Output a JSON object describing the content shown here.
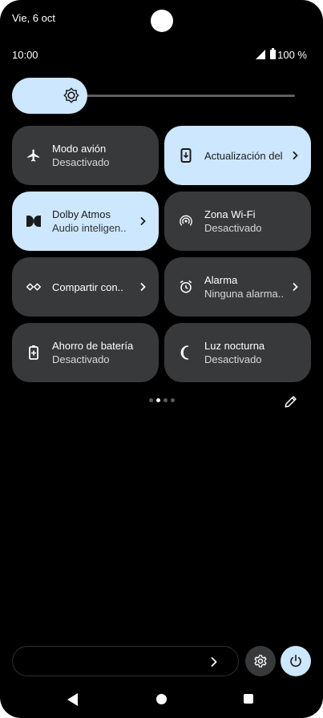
{
  "status": {
    "date": "Vie, 6 oct",
    "time": "10:00",
    "battery": "100 %"
  },
  "brightness": {
    "level": 0.25,
    "icon": "brightness-icon"
  },
  "tiles": [
    {
      "title": "Modo avión",
      "subtitle": "Desactivado",
      "icon": "airplane-icon",
      "active": false,
      "chevron": false
    },
    {
      "title": "Actualización del sistema",
      "subtitle": "",
      "icon": "system-update-icon",
      "active": true,
      "chevron": true
    },
    {
      "title": "Dolby Atmos",
      "subtitle": "Audio inteligen..",
      "icon": "dolby-icon",
      "active": true,
      "chevron": true
    },
    {
      "title": "Zona Wi-Fi",
      "subtitle": "Desactivado",
      "icon": "hotspot-icon",
      "active": false,
      "chevron": false
    },
    {
      "title": "Compartir con..",
      "subtitle": "",
      "icon": "nearby-share-icon",
      "active": false,
      "chevron": true
    },
    {
      "title": "Alarma",
      "subtitle": "Ninguna alarma..",
      "icon": "alarm-icon",
      "active": false,
      "chevron": true
    },
    {
      "title": "Ahorro de batería",
      "subtitle": "Desactivado",
      "icon": "battery-saver-icon",
      "active": false,
      "chevron": false
    },
    {
      "title": "Luz nocturna",
      "subtitle": "Desactivado",
      "icon": "night-light-icon",
      "active": false,
      "chevron": false
    }
  ],
  "pager": {
    "pages": 4,
    "current": 2
  },
  "colors": {
    "background": "#000000",
    "tile": "#38393b",
    "tile_active": "#cde7ff"
  }
}
